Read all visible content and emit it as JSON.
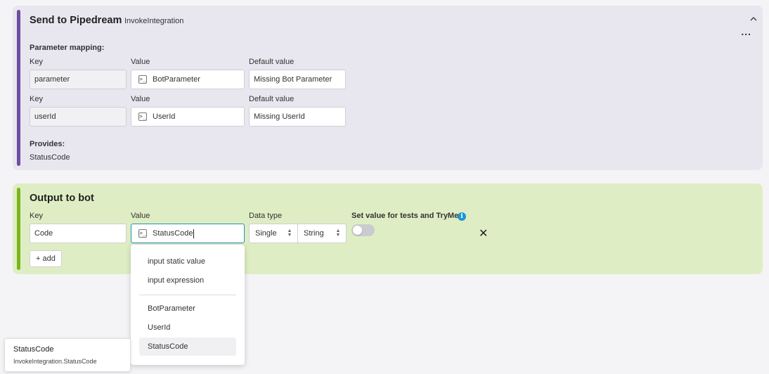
{
  "pipedream": {
    "title": "Send to Pipedream",
    "subtitle": "InvokeIntegration",
    "more_label": "...",
    "mapping_label": "Parameter mapping:",
    "rows": [
      {
        "key_label": "Key",
        "value_label": "Value",
        "default_label": "Default value",
        "key": "parameter",
        "value": "BotParameter",
        "default": "Missing Bot Parameter"
      },
      {
        "key_label": "Key",
        "value_label": "Value",
        "default_label": "Default value",
        "key": "userId",
        "value": "UserId",
        "default": "Missing UserId"
      }
    ],
    "provides_label": "Provides:",
    "provides_value": "StatusCode",
    "accent_color": "#6a4fa3"
  },
  "output": {
    "title": "Output to bot",
    "key_label": "Key",
    "value_label": "Value",
    "data_type_label": "Data type",
    "set_value_label": "Set value for tests and TryMe",
    "key": "Code",
    "value": "StatusCode",
    "data_type_mode": "Single",
    "data_type_kind": "String",
    "close_label": "✕",
    "add_label": "+ add",
    "accent_color": "#7ab51d"
  },
  "dropdown": {
    "items": [
      "input static value",
      "input expression",
      "BotParameter",
      "UserId",
      "StatusCode"
    ],
    "selected": "StatusCode"
  },
  "tooltip": {
    "title": "StatusCode",
    "detail": "InvokeIntegration.StatusCode"
  },
  "icons": {
    "expression": "terminal-icon",
    "info": "info-icon"
  }
}
